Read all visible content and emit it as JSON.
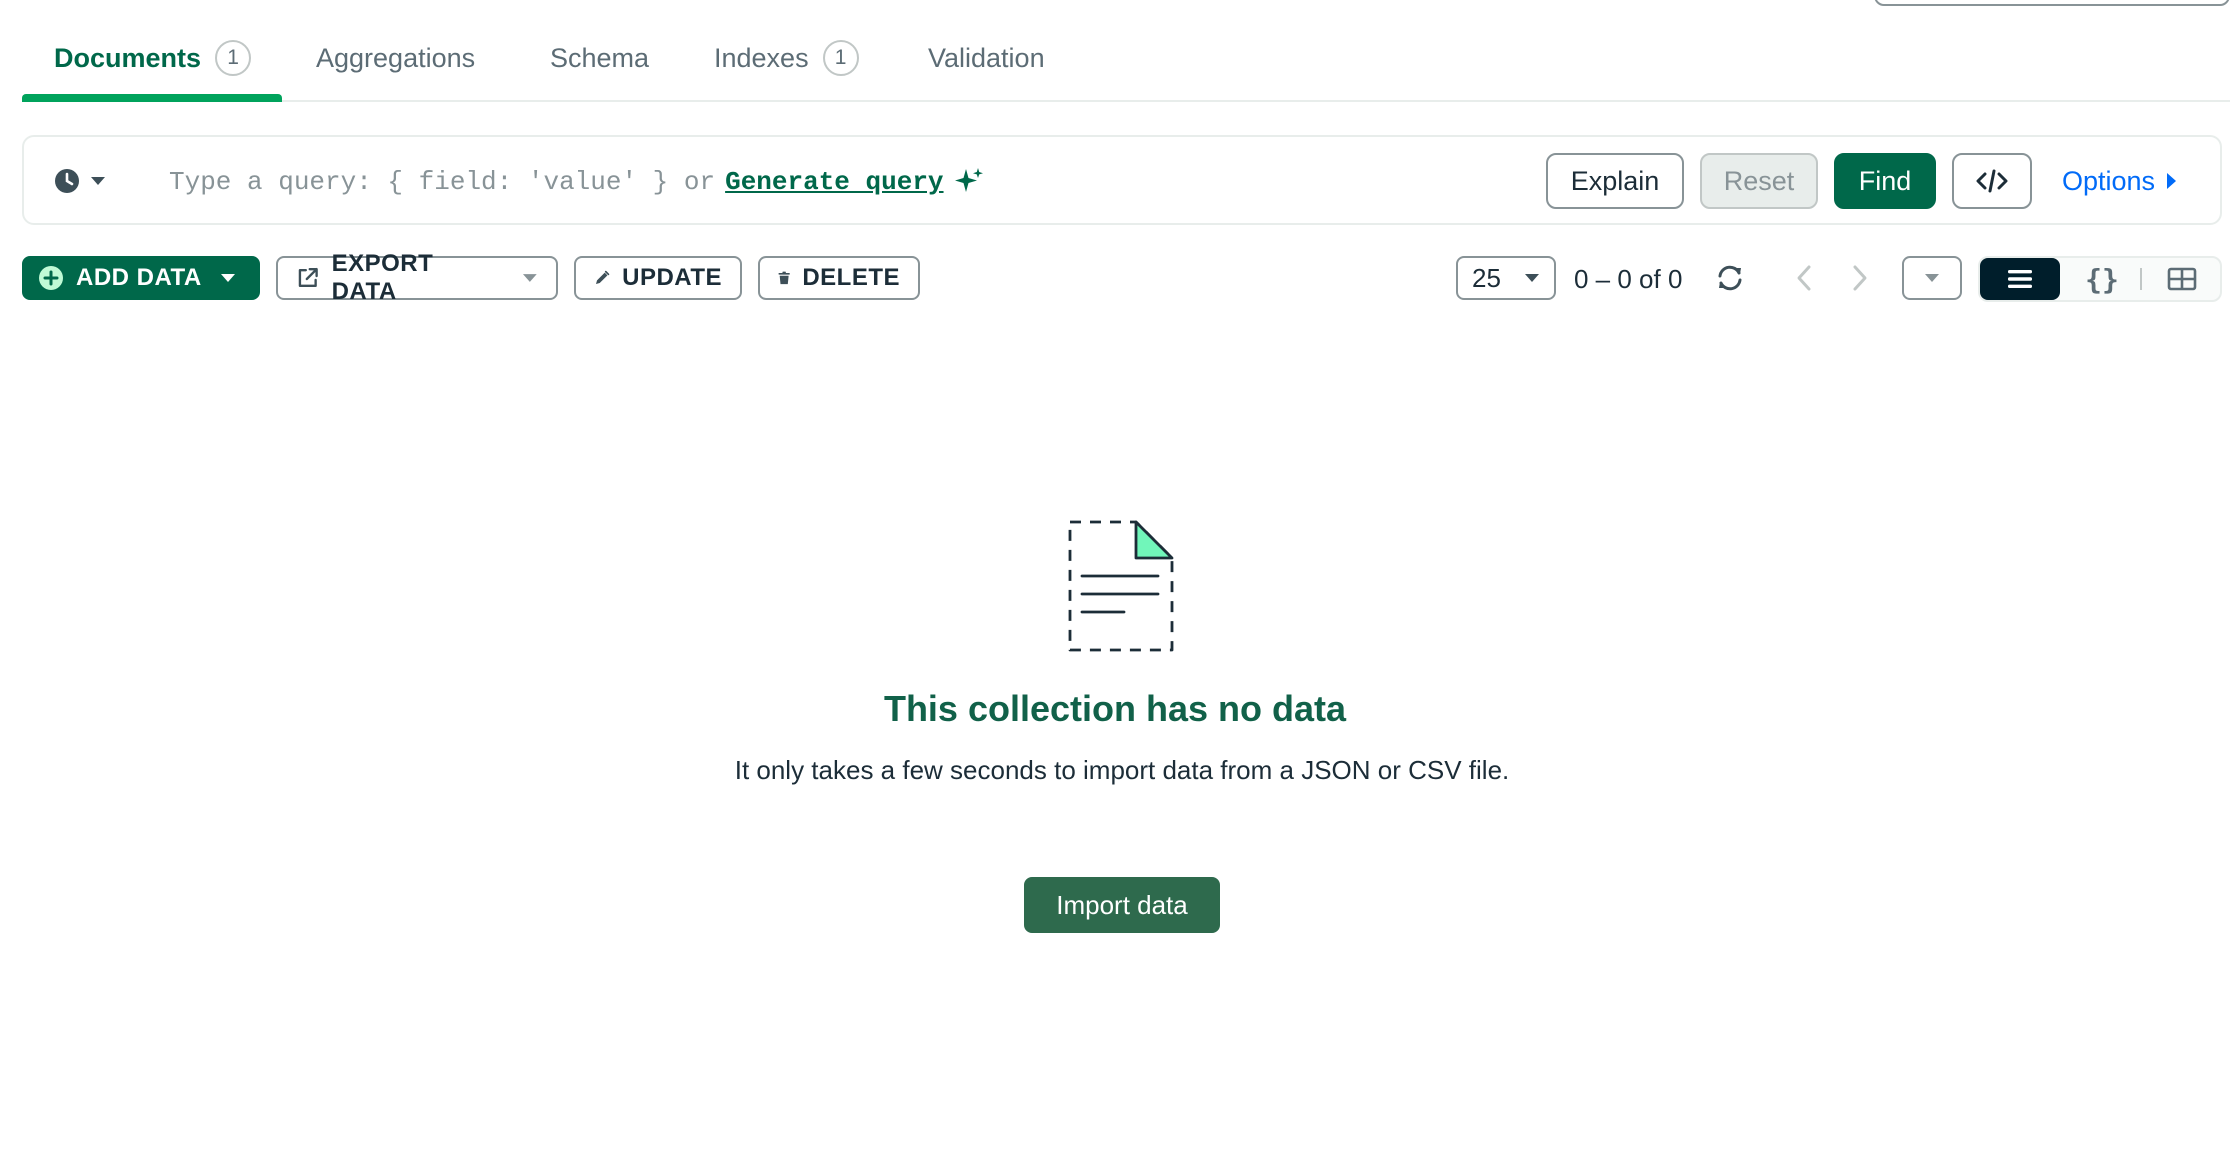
{
  "tabs": [
    {
      "label": "Documents",
      "count": "1",
      "active": true
    },
    {
      "label": "Aggregations"
    },
    {
      "label": "Schema"
    },
    {
      "label": "Indexes",
      "count": "1"
    },
    {
      "label": "Validation"
    }
  ],
  "query": {
    "placeholder": "Type a query: { field: 'value' } or",
    "generate_label": "Generate query",
    "explain_label": "Explain",
    "reset_label": "Reset",
    "find_label": "Find",
    "options_label": "Options"
  },
  "toolbar": {
    "add_data_label": "ADD DATA",
    "export_data_label": "EXPORT DATA",
    "update_label": "UPDATE",
    "delete_label": "DELETE",
    "page_size": "25",
    "range_text": "0 – 0 of 0",
    "json_view_glyph": "{}"
  },
  "empty_state": {
    "title": "This collection has no data",
    "description": "It only takes a few seconds to import data from a JSON or CSV file.",
    "import_label": "Import data"
  },
  "colors": {
    "brand_green": "#00684a",
    "accent_green": "#00a35c",
    "link_blue": "#016bf8",
    "dark_navy": "#001e2b"
  }
}
